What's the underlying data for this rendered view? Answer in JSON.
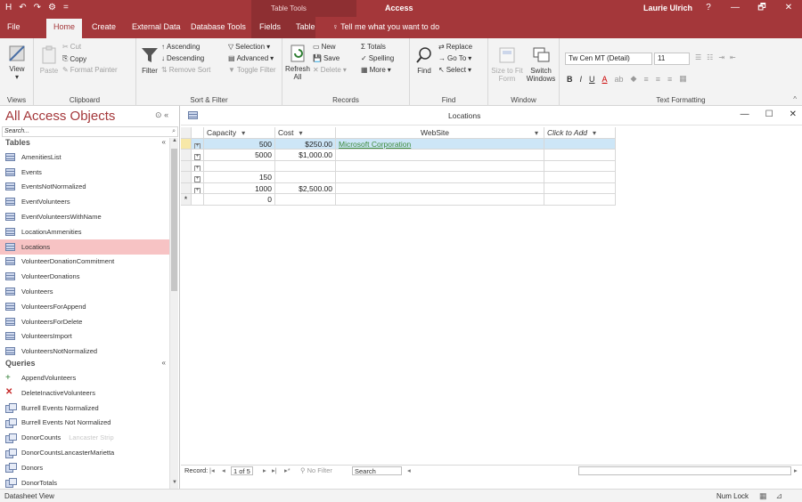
{
  "titlebar": {
    "quick_access": [
      "H",
      "↶",
      "↷",
      "⚙",
      "="
    ],
    "contextual_label": "Table Tools",
    "app_title": "Access",
    "user": "Laurie Ulrich",
    "help": "?",
    "minimize": "—",
    "restore": "🗗",
    "close": "✕"
  },
  "tabs": {
    "file": "File",
    "home": "Home",
    "create": "Create",
    "external_data": "External Data",
    "database_tools": "Database Tools",
    "fields": "Fields",
    "table": "Table",
    "tell_me": "Tell me what you want to do"
  },
  "ribbon": {
    "views": {
      "view": "View",
      "label": "Views"
    },
    "clipboard": {
      "paste": "Paste",
      "cut": "Cut",
      "copy": "Copy",
      "format_painter": "Format Painter",
      "label": "Clipboard"
    },
    "sort_filter": {
      "filter": "Filter",
      "ascending": "Ascending",
      "descending": "Descending",
      "remove_sort": "Remove Sort",
      "selection": "Selection",
      "advanced": "Advanced",
      "toggle_filter": "Toggle Filter",
      "label": "Sort & Filter"
    },
    "records": {
      "refresh_all": "Refresh All",
      "new": "New",
      "save": "Save",
      "delete": "Delete",
      "totals": "Totals",
      "spelling": "Spelling",
      "more": "More",
      "label": "Records"
    },
    "find": {
      "find": "Find",
      "replace": "Replace",
      "goto": "Go To",
      "select": "Select",
      "label": "Find"
    },
    "window": {
      "size_to_fit": "Size to Fit Form",
      "switch_windows": "Switch Windows",
      "label": "Window"
    },
    "text_formatting": {
      "font": "Tw Cen MT (Detail)",
      "size": "11",
      "bold": "B",
      "italic": "I",
      "underline": "U",
      "label": "Text Formatting"
    }
  },
  "nav": {
    "title": "All Access Objects",
    "search_placeholder": "Search...",
    "tables_label": "Tables",
    "tables": [
      "AmenitiesList",
      "Events",
      "EventsNotNormalized",
      "EventVolunteers",
      "EventVolunteersWithName",
      "LocationAmmenities",
      "Locations",
      "VolunteerDonationCommitment",
      "VolunteerDonations",
      "Volunteers",
      "VolunteersForAppend",
      "VolunteersForDelete",
      "VolunteersImport",
      "VolunteersNotNormalized"
    ],
    "queries_label": "Queries",
    "queries": [
      "AppendVolunteers",
      "DeleteInactiveVolunteers",
      "Burrell Events Normalized",
      "Burrell Events Not Normalized",
      "DonorCounts",
      "DonorCountsLancasterMarietta",
      "Donors",
      "DonorTotals"
    ],
    "ghost_text": "Lancaster Strip"
  },
  "document": {
    "title": "Locations",
    "minimize": "—",
    "maximize": "☐",
    "close": "✕",
    "columns": [
      "Capacity",
      "Cost",
      "WebSite",
      "Click to Add"
    ],
    "rows": [
      {
        "capacity": "500",
        "cost": "$250.00",
        "website": "Microsoft Corporation"
      },
      {
        "capacity": "5000",
        "cost": "$1,000.00",
        "website": ""
      },
      {
        "capacity": "",
        "cost": "",
        "website": ""
      },
      {
        "capacity": "150",
        "cost": "",
        "website": ""
      },
      {
        "capacity": "1000",
        "cost": "$2,500.00",
        "website": ""
      },
      {
        "capacity": "0",
        "cost": "",
        "website": ""
      }
    ],
    "record_nav": {
      "label": "Record:",
      "position": "1 of 5",
      "no_filter": "No Filter",
      "search": "Search"
    }
  },
  "status": {
    "left": "Datasheet View",
    "num_lock": "Num Lock"
  }
}
